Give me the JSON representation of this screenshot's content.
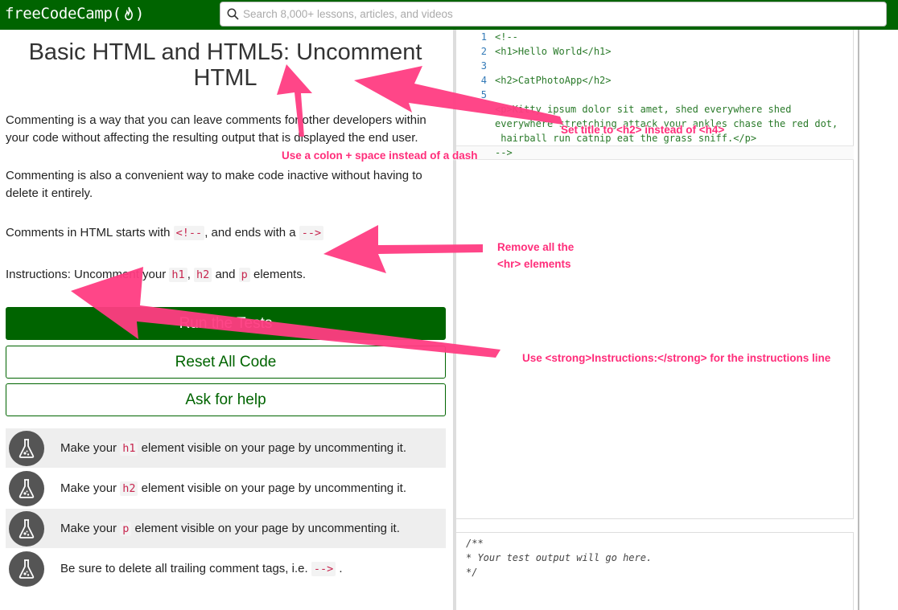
{
  "navbar": {
    "brand": "freeCodeCamp(",
    "brand_end": ")",
    "search_placeholder": "Search 8,000+ lessons, articles, and videos"
  },
  "challenge": {
    "title": "Basic HTML and HTML5: Uncomment HTML",
    "p1": "Commenting is a way that you can leave comments for other developers within your code without affecting the resulting output that is displayed the end user.",
    "p2": "Commenting is also a convenient way to make code inactive without having to delete it entirely.",
    "p3_start": "Comments in HTML starts with",
    "p3_code1": "<!--",
    "p3_mid": ", and ends with a",
    "p3_code2": "-->",
    "p4_start": "Instructions: Uncomment your",
    "p4_code1": "h1",
    "p4_sep": ",",
    "p4_code2": "h2",
    "p4_and": "and",
    "p4_code3": "p",
    "p4_end": "elements."
  },
  "buttons": {
    "run": "Run the Tests",
    "reset": "Reset All Code",
    "help": "Ask for help"
  },
  "tests": [
    {
      "pre": "Make your",
      "code": "h1",
      "post": "element visible on your page by uncommenting it."
    },
    {
      "pre": "Make your",
      "code": "h2",
      "post": "element visible on your page by uncommenting it."
    },
    {
      "pre": "Make your",
      "code": "p",
      "post": "element visible on your page by uncommenting it."
    },
    {
      "pre": "Be sure to delete all trailing comment tags, i.e.",
      "code": "-->",
      "post": "."
    }
  ],
  "editor": {
    "lines": [
      {
        "n": "1",
        "text": "<!--"
      },
      {
        "n": "2",
        "text": "<h1>Hello World</h1>"
      },
      {
        "n": "3",
        "text": ""
      },
      {
        "n": "4",
        "text": "<h2>CatPhotoApp</h2>"
      },
      {
        "n": "5",
        "text": ""
      },
      {
        "n": "",
        "text": "<p>Kitty ipsum dolor sit amet, shed everywhere shed"
      },
      {
        "n": "",
        "text": "everywhere stretching attack your ankles chase the red dot,"
      },
      {
        "n": "",
        "text": " hairball run catnip eat the grass sniff.</p>"
      },
      {
        "n": "",
        "text": "-->"
      }
    ]
  },
  "output": {
    "text": "/**\n* Your test output will go here.\n*/"
  },
  "annotations": {
    "colon": "Use a colon + space instead of a dash",
    "title": "Set title to <h2> instead of <h4>",
    "hr_line1": "Remove all the",
    "hr_line2": "<hr> elements",
    "strong": "Use <strong>Instructions:</strong> for the instructions line",
    "color": "#ff2d7a"
  },
  "colors": {
    "nav_bg": "#006400",
    "primary": "#006400",
    "code_red": "#c7254e",
    "flask_bg": "#555555"
  }
}
